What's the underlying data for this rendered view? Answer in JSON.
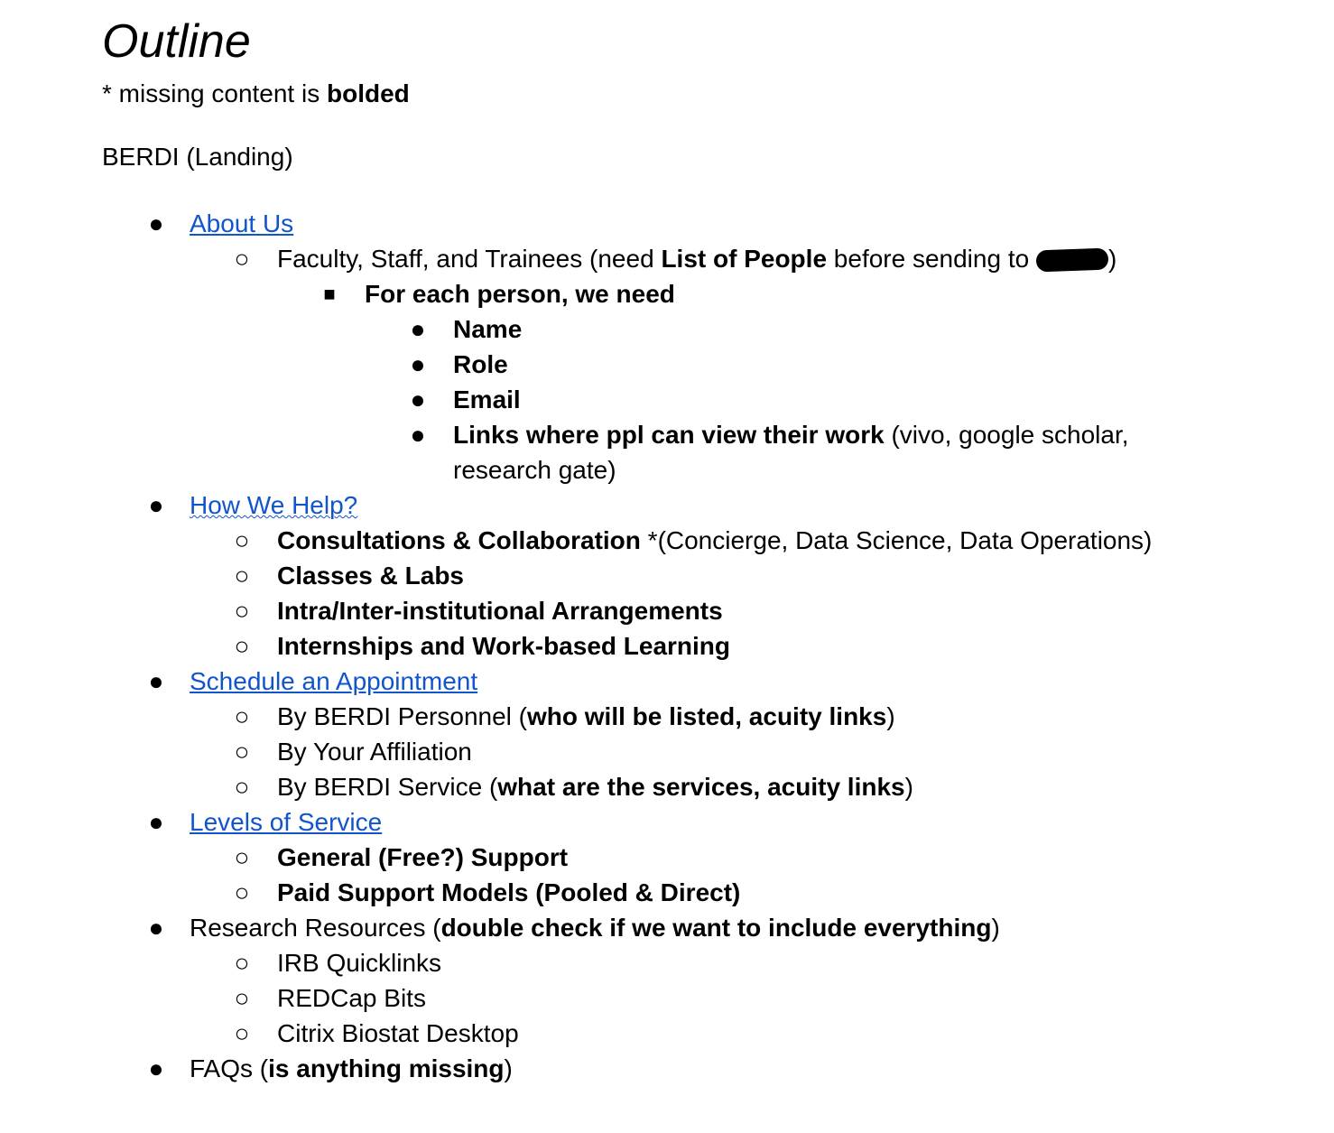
{
  "title": "Outline",
  "note": {
    "prefix": "* missing content is ",
    "bold": "bolded"
  },
  "landing": "BERDI (Landing)",
  "about": {
    "label": "About Us",
    "faculty": {
      "prefix": "Faculty, Staff, and Trainees (need ",
      "bold": "List of People",
      "suffix": " before sending to ",
      "close": ")"
    },
    "for_each": "For each person, we need",
    "needs": [
      "Name",
      "Role",
      "Email"
    ],
    "links": {
      "bold": "Links where ppl can view their work",
      "rest": " (vivo, google scholar, research gate)"
    }
  },
  "help": {
    "label": "How We Help?",
    "consult": {
      "bold": "Consultations & Collaboration",
      "rest": " *(Concierge, Data Science, Data Operations)"
    },
    "items": [
      "Classes & Labs",
      "Intra/Inter-institutional Arrangements",
      "Internships and Work-based Learning"
    ]
  },
  "schedule": {
    "label": "Schedule an Appointment",
    "personnel": {
      "prefix": "By BERDI Personnel (",
      "bold": "who will be listed, acuity links",
      "suffix": ")"
    },
    "affiliation": "By Your Affiliation",
    "service": {
      "prefix": "By BERDI Service (",
      "bold": "what are the services, acuity links",
      "suffix": ")"
    }
  },
  "levels": {
    "label": "Levels of Service",
    "items": [
      "General (Free?) Support",
      "Paid Support Models (Pooled & Direct)"
    ]
  },
  "research": {
    "prefix": "Research Resources (",
    "bold": "double check if we want to include everything",
    "suffix": ")",
    "items": [
      "IRB Quicklinks",
      "REDCap Bits",
      "Citrix Biostat Desktop"
    ]
  },
  "faqs": {
    "prefix": "FAQs (",
    "bold": "is anything missing",
    "suffix": ")"
  },
  "bullets": {
    "l1": "●",
    "l2": "○",
    "l3": "■",
    "l4": "●"
  }
}
